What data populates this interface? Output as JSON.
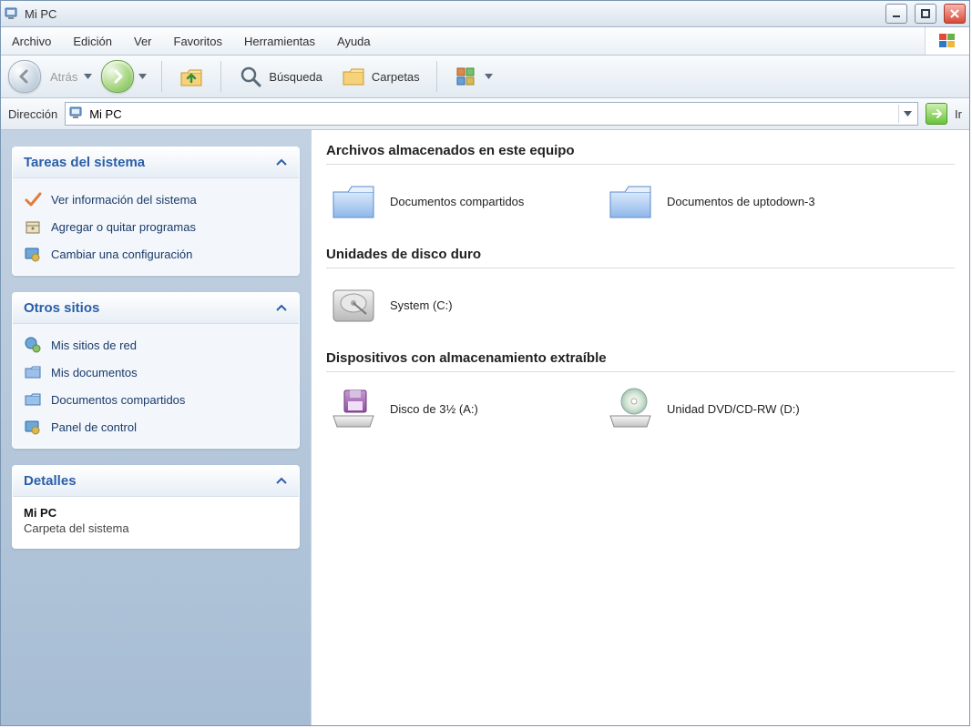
{
  "window": {
    "title": "Mi PC"
  },
  "menubar": {
    "items": [
      "Archivo",
      "Edición",
      "Ver",
      "Favoritos",
      "Herramientas",
      "Ayuda"
    ]
  },
  "toolbar": {
    "back_label": "Atrás",
    "search_label": "Búsqueda",
    "folders_label": "Carpetas"
  },
  "address": {
    "label": "Dirección",
    "value": "Mi PC",
    "go_label": "Ir"
  },
  "sidebar": {
    "panels": [
      {
        "title": "Tareas del sistema",
        "links": [
          {
            "icon": "checkmark",
            "label": "Ver información del sistema"
          },
          {
            "icon": "box",
            "label": "Agregar o quitar programas"
          },
          {
            "icon": "gear",
            "label": "Cambiar una configuración"
          }
        ]
      },
      {
        "title": "Otros sitios",
        "links": [
          {
            "icon": "network",
            "label": "Mis sitios de red"
          },
          {
            "icon": "folder",
            "label": "Mis documentos"
          },
          {
            "icon": "folder",
            "label": "Documentos compartidos"
          },
          {
            "icon": "gear",
            "label": "Panel de control"
          }
        ]
      },
      {
        "title": "Detalles",
        "details": {
          "name": "Mi PC",
          "subtitle": "Carpeta del sistema"
        }
      }
    ]
  },
  "content": {
    "groups": [
      {
        "heading": "Archivos almacenados en este equipo",
        "items": [
          {
            "icon": "folder",
            "label": "Documentos compartidos"
          },
          {
            "icon": "folder",
            "label": "Documentos de uptodown-3"
          }
        ]
      },
      {
        "heading": "Unidades de disco duro",
        "items": [
          {
            "icon": "hdd",
            "label": "System (C:)"
          }
        ]
      },
      {
        "heading": "Dispositivos con almacenamiento extraíble",
        "items": [
          {
            "icon": "floppy",
            "label": "Disco de 3½ (A:)"
          },
          {
            "icon": "dvd",
            "label": "Unidad DVD/CD-RW (D:)"
          }
        ]
      }
    ]
  }
}
